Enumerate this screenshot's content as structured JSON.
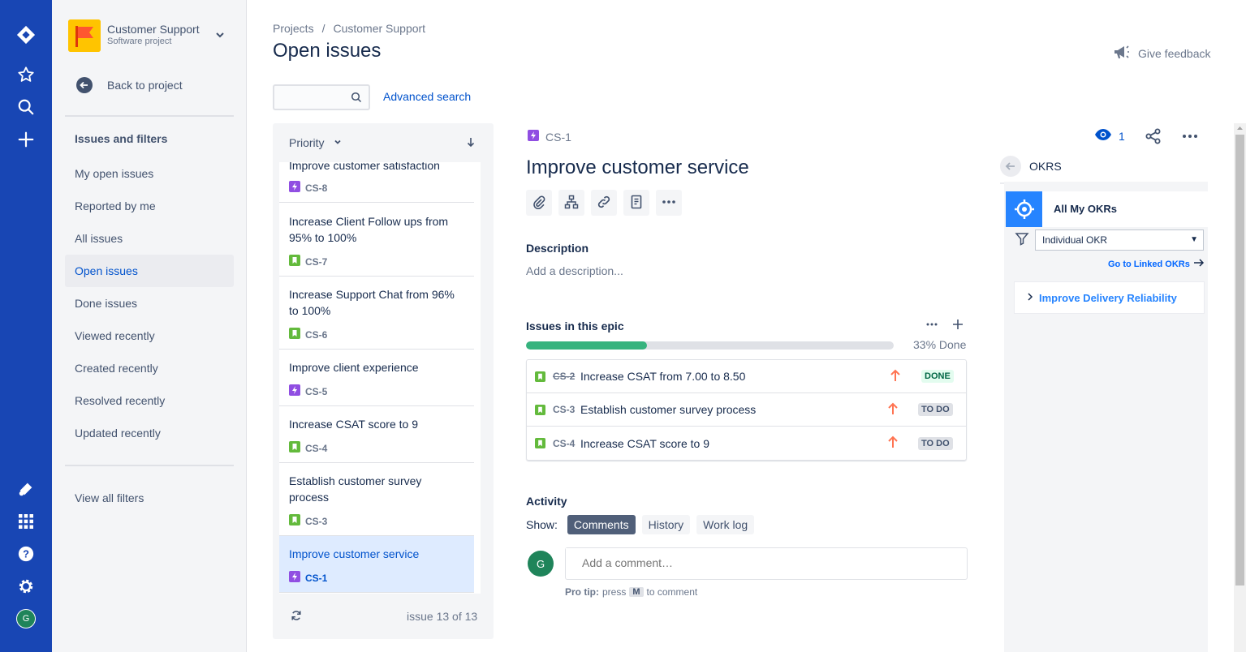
{
  "colors": {
    "brand_nav": "#1846B4",
    "link": "#0052CC",
    "progress": "#36B37E",
    "okr_blue": "#2684FF"
  },
  "global_nav": {
    "user_initial": "G"
  },
  "project": {
    "name": "Customer Support",
    "type": "Software project",
    "back_label": "Back to project"
  },
  "sidebar": {
    "heading": "Issues and filters",
    "items": [
      {
        "label": "My open issues"
      },
      {
        "label": "Reported by me"
      },
      {
        "label": "All issues"
      },
      {
        "label": "Open issues"
      },
      {
        "label": "Done issues"
      },
      {
        "label": "Viewed recently"
      },
      {
        "label": "Created recently"
      },
      {
        "label": "Resolved recently"
      },
      {
        "label": "Updated recently"
      }
    ],
    "view_all": "View all filters"
  },
  "header": {
    "breadcrumb": [
      "Projects",
      "/",
      "Customer Support"
    ],
    "title": "Open issues",
    "feedback": "Give feedback",
    "search_placeholder": "",
    "advanced_search": "Advanced search"
  },
  "list": {
    "sort_label": "Priority",
    "cards": [
      {
        "title": "Improve customer satisfaction",
        "key": "CS-8",
        "kind": "epic"
      },
      {
        "title": "Increase Client Follow ups from 95% to 100%",
        "key": "CS-7",
        "kind": "story"
      },
      {
        "title": "Increase Support Chat from 96% to 100%",
        "key": "CS-6",
        "kind": "story"
      },
      {
        "title": "Improve client experience",
        "key": "CS-5",
        "kind": "epic"
      },
      {
        "title": "Increase CSAT score to 9",
        "key": "CS-4",
        "kind": "story"
      },
      {
        "title": "Establish customer survey process",
        "key": "CS-3",
        "kind": "story"
      },
      {
        "title": "Improve customer service",
        "key": "CS-1",
        "kind": "epic"
      }
    ],
    "count": "issue 13 of 13"
  },
  "issue": {
    "key": "CS-1",
    "watchers": "1",
    "title": "Improve customer service",
    "description_heading": "Description",
    "description_placeholder": "Add a description...",
    "epic_heading": "Issues in this epic",
    "progress_pct": 33,
    "progress_label": "33% Done",
    "children": [
      {
        "key": "CS-2",
        "summary": "Increase CSAT from 7.00 to 8.50",
        "status": "DONE"
      },
      {
        "key": "CS-3",
        "summary": "Establish customer survey process",
        "status": "TO DO"
      },
      {
        "key": "CS-4",
        "summary": "Increase CSAT score to 9",
        "status": "TO DO"
      }
    ],
    "activity_heading": "Activity",
    "show_label": "Show:",
    "filters": [
      "Comments",
      "History",
      "Work log"
    ],
    "comment_avatar": "G",
    "comment_placeholder": "Add a comment…",
    "protip_bold": "Pro tip:",
    "protip_press": "press",
    "protip_key": "M",
    "protip_rest": "to comment"
  },
  "okr": {
    "panel_title": "OKRS",
    "app_title": "All My OKRs",
    "select_value": "Individual OKR",
    "linked": "Go to Linked OKRs",
    "item": "Improve Delivery Reliability"
  }
}
